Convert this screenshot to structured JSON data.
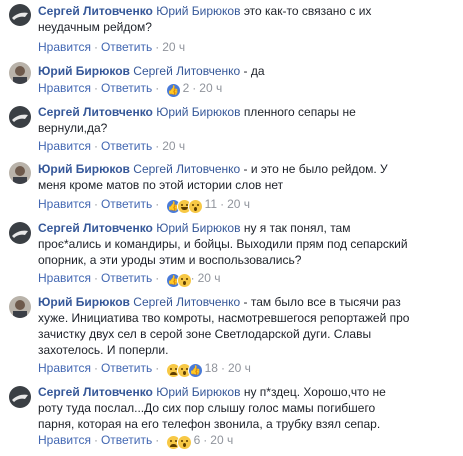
{
  "actions": {
    "like": "Нравится",
    "reply": "Ответить"
  },
  "comments": [
    {
      "author": "Сергей Литовченко",
      "mention": "Юрий Бирюков",
      "text": "это как-то связано с их неудачным рейдом?",
      "time": "20 ч",
      "reactions": [],
      "count": ""
    },
    {
      "author": "Юрий Бирюков",
      "mention": "Сергей Литовченко",
      "text": "- да",
      "time": "20 ч",
      "reactions": [
        "like"
      ],
      "count": "2"
    },
    {
      "author": "Сергей Литовченко",
      "mention": "Юрий Бирюков",
      "text": "пленного сепары не вернули,да?",
      "time": "20 ч",
      "reactions": [],
      "count": ""
    },
    {
      "author": "Юрий Бирюков",
      "mention": "Сергей Литовченко",
      "text": "- и это не было рейдом. У меня кроме матов по этой истории слов нет",
      "time": "20 ч",
      "reactions": [
        "like",
        "haha",
        "wow"
      ],
      "count": "11"
    },
    {
      "author": "Сергей Литовченко",
      "mention": "Юрий Бирюков",
      "text": "ну я так понял, там проє*ались и командиры, и бойцы. Выходили прям под сепарский опорник, а эти уроды этим и воспользовались?",
      "time": "20 ч",
      "reactions": [
        "like",
        "wow"
      ],
      "count": ""
    },
    {
      "author": "Юрий Бирюков",
      "mention": "Сергей Литовченко",
      "text": "- там было все в тысячи раз хуже. Инициатива тво комроты, насмотревшегося репортажей про зачистку двух сел в серой зоне Светлодарской дуги. Славы захотелось. И поперли.",
      "time": "20 ч",
      "reactions": [
        "sad",
        "wow",
        "like"
      ],
      "count": "18"
    },
    {
      "author": "Сергей Литовченко",
      "mention": "Юрий Бирюков",
      "text": "ну п*здец. Хорошо,что не роту туда послал...До сих пор слышу голос мамы погибшего парня, которая на его телефон звонила, а трубку взял сепар.",
      "time": "20 ч",
      "reactions": [
        "sad",
        "wow"
      ],
      "count": "6"
    }
  ]
}
